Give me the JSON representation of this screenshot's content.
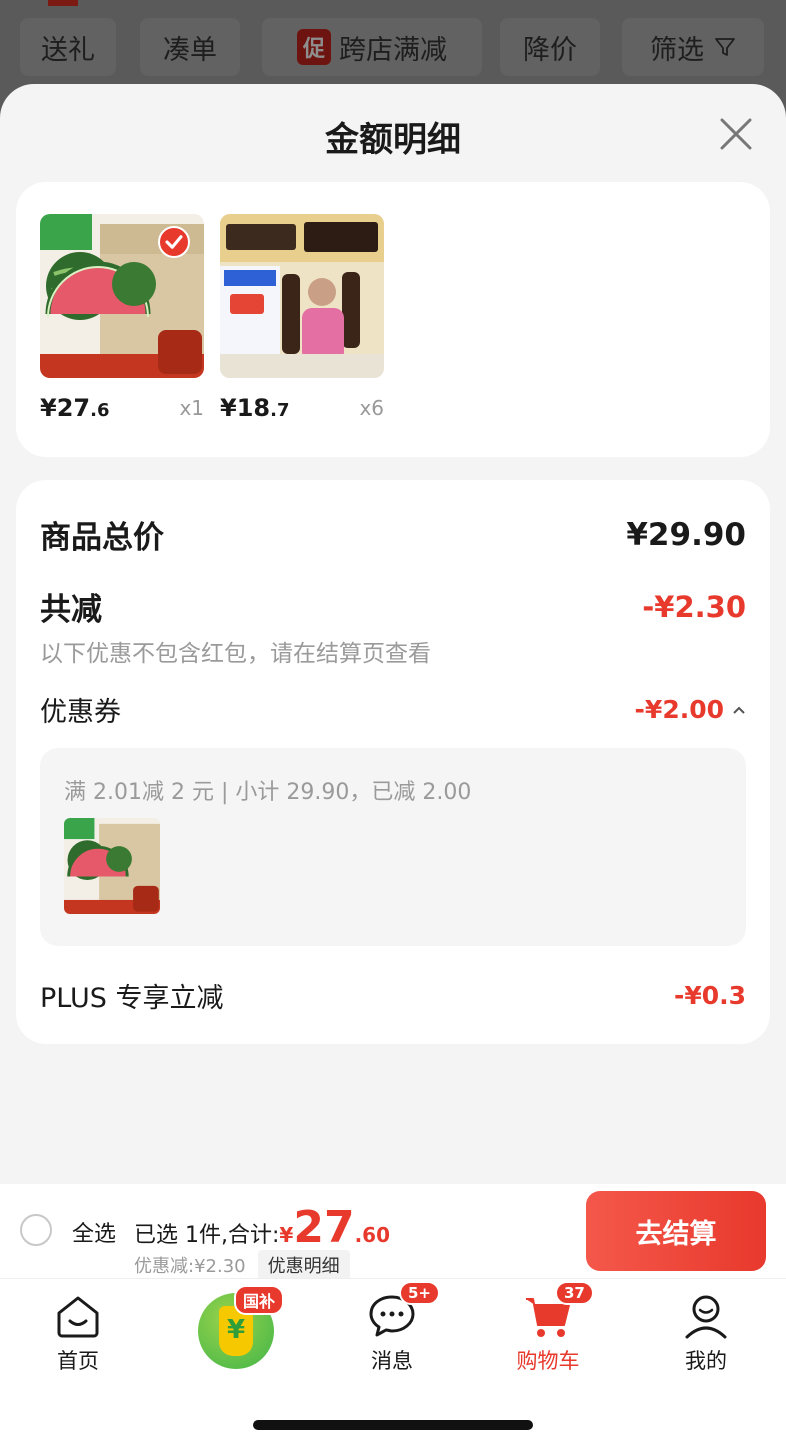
{
  "filter_bar": {
    "items": [
      {
        "label": "送礼"
      },
      {
        "label": "凑单"
      },
      {
        "label": "跨店满减",
        "tag": "促"
      },
      {
        "label": "降价"
      },
      {
        "label": "筛选"
      }
    ]
  },
  "sheet": {
    "title": "金额明细",
    "products": [
      {
        "name": "watermelon",
        "price_int": "¥27",
        "price_dec": ".6",
        "qty": "x1",
        "selected": true,
        "img_text": {
          "tag_line1": "一件",
          "tag_line2": "包邮",
          "brand": "麒麟西瓜",
          "box": "源头直发",
          "banner": "麒麟西瓜会存在少量黑籽",
          "sub": "汁水丰盈 果肉红润",
          "seal1": "脆甜",
          "seal2": "多汁"
        }
      },
      {
        "name": "ice-cream",
        "price_int": "¥18",
        "price_dec": ".7",
        "qty": "x6",
        "selected": false,
        "img_text": {
          "headline": "巧脆棒",
          "headline2": "重磅升级",
          "promo1": "热卖爆款",
          "promo2": "限时抢购",
          "discount": "5折",
          "bar": "巧脆棒"
        }
      }
    ],
    "summary": {
      "total_label": "商品总价",
      "total_value": "¥29.90",
      "reduce_label": "共减",
      "reduce_value": "-¥2.30",
      "reduce_hint": "以下优惠不包含红包，请在结算页查看",
      "coupon_label": "优惠券",
      "coupon_value": "-¥2.00",
      "coupon_desc": "满 2.01减 2 元 | 小计 29.90，已减 2.00",
      "plus_label": "PLUS 专享立减",
      "plus_value": "-¥0.3"
    }
  },
  "checkout": {
    "select_all": "全选",
    "selected_text": "已选 1件,合计:",
    "total_currency": "¥",
    "total_int": "27",
    "total_dec": ".60",
    "discount_text": "优惠减:¥2.30",
    "detail_label": "优惠明细",
    "pay_label": "去结算"
  },
  "tabbar": {
    "tabs": [
      {
        "label": "首页",
        "icon": "home-icon"
      },
      {
        "label": "国补",
        "icon": "subsidy-icon"
      },
      {
        "label": "消息",
        "icon": "message-icon",
        "badge": "5+"
      },
      {
        "label": "购物车",
        "icon": "cart-icon",
        "badge": "37",
        "active": true
      },
      {
        "label": "我的",
        "icon": "profile-icon"
      }
    ]
  },
  "colors": {
    "accent": "#e8392d",
    "sheet_bg": "#f4f4f4",
    "overlay": "#5f5f5f"
  }
}
